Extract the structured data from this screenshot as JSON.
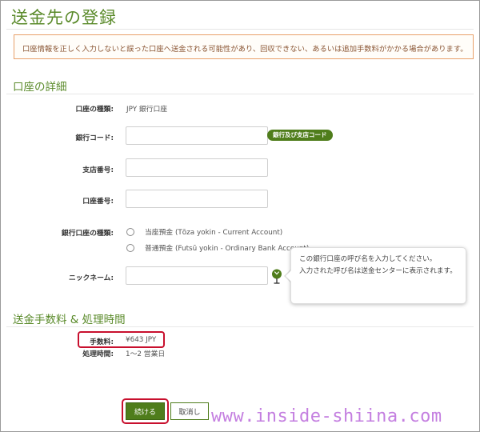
{
  "page": {
    "title": "送金先の登録",
    "warning": "口座情報を正しく入力しないと誤った口座へ送金される可能性があり、回収できない、あるいは追加手数料がかかる場合があります。"
  },
  "account_details": {
    "heading": "口座の詳細",
    "account_type_label": "口座の種類:",
    "account_type_value": "JPY 銀行口座",
    "bank_code_label": "銀行コード:",
    "bank_code_value": "",
    "bank_branch_button": "銀行及び支店コード",
    "branch_number_label": "支店番号:",
    "branch_number_value": "",
    "account_number_label": "口座番号:",
    "account_number_value": "",
    "bank_account_kind_label": "銀行口座の種類:",
    "radio_options": [
      "当座預金 (Tōza yokin - Current Account)",
      "普通預金 (Futsū yokin - Ordinary Bank Account)"
    ],
    "nickname_label": "ニックネーム:",
    "nickname_value": "",
    "nickname_tooltip_line1": "この銀行口座の呼び名を入力してください。",
    "nickname_tooltip_line2": "入力された呼び名は送金センターに表示されます。"
  },
  "fees": {
    "heading": "送金手数料 & 処理時間",
    "fee_label": "手数料:",
    "fee_value": "¥643 JPY",
    "processing_label": "処理時間:",
    "processing_value": "1～2 営業日"
  },
  "actions": {
    "continue_label": "続ける",
    "cancel_label": "取消し"
  },
  "watermark": "www.inside-shiina.com",
  "colors": {
    "accent_green": "#4f7d1b",
    "heading_green": "#5a8a2a",
    "warning_border": "#e8a06a",
    "highlight_red": "#c8102e",
    "watermark_purple": "#c47fe0"
  },
  "icons": {
    "nickname_help": "help-pin-icon"
  }
}
